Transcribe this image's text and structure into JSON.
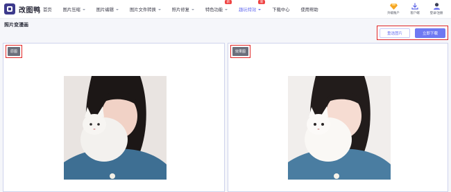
{
  "app": {
    "logo_text": "改图鸭"
  },
  "nav": {
    "items": [
      {
        "label": "首页",
        "has_dropdown": false,
        "badge": "",
        "active": false
      },
      {
        "label": "图片压缩",
        "has_dropdown": true,
        "badge": "",
        "active": false
      },
      {
        "label": "图片编辑",
        "has_dropdown": true,
        "badge": "",
        "active": false
      },
      {
        "label": "图片文件转换",
        "has_dropdown": true,
        "badge": "",
        "active": false
      },
      {
        "label": "照片修复",
        "has_dropdown": true,
        "badge": "",
        "active": false
      },
      {
        "label": "特色功能",
        "has_dropdown": true,
        "badge": "新",
        "active": false
      },
      {
        "label": "趣玩特效",
        "has_dropdown": true,
        "badge": "新",
        "active": true
      },
      {
        "label": "下载中心",
        "has_dropdown": false,
        "badge": "",
        "active": false
      },
      {
        "label": "使用帮助",
        "has_dropdown": false,
        "badge": "",
        "active": false
      }
    ]
  },
  "user_tools": {
    "upgrade_label": "升级账户",
    "client_label": "客户端",
    "login_label": "登录/注册"
  },
  "page": {
    "title": "照片变漫画"
  },
  "actions": {
    "reselect_label": "重选图片",
    "download_label": "立即下载"
  },
  "panels": {
    "original_tag": "原图",
    "result_tag": "效果图"
  },
  "colors": {
    "accent": "#6f79f2",
    "highlight_box": "#e02424",
    "badge": "#ef4444",
    "upgrade_icon": "#f5a623"
  },
  "icons": {
    "upgrade": "diamond-icon",
    "client": "download-icon",
    "login": "user-avatar-icon"
  }
}
